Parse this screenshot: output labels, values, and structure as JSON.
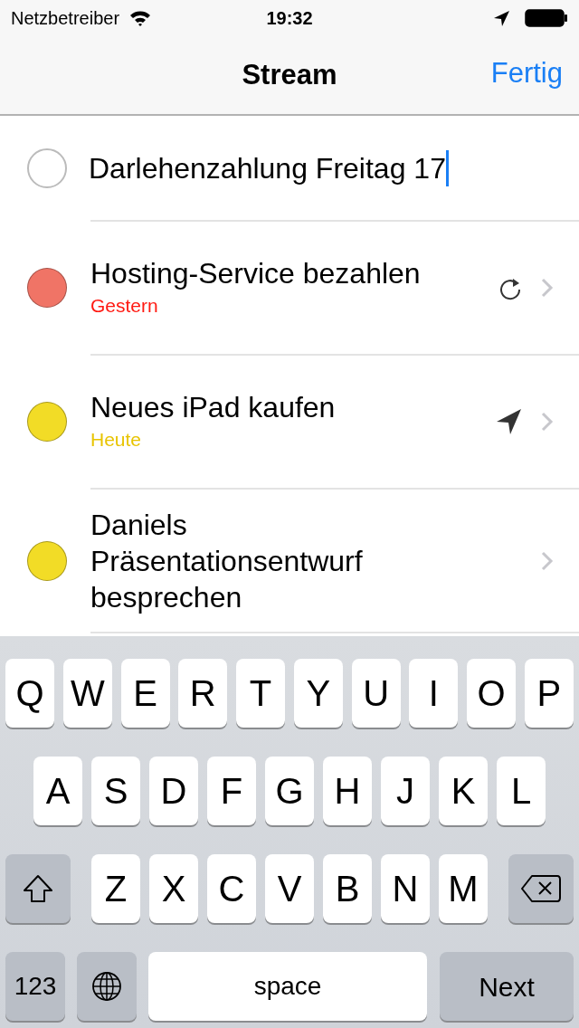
{
  "status_bar": {
    "carrier": "Netzbetreiber",
    "time": "19:32"
  },
  "nav": {
    "title": "Stream",
    "done": "Fertig"
  },
  "new_task": {
    "value": "Darlehenzahlung Freitag 17"
  },
  "tasks": [
    {
      "title": "Hosting-Service bezahlen",
      "color": "#f07466",
      "due": {
        "text": "Gestern",
        "color": "#ff1a12"
      },
      "kind": "repeat"
    },
    {
      "title": "Neues iPad kaufen",
      "color": "#f2dc26",
      "due": {
        "text": "Heute",
        "color": "#e8c400"
      },
      "kind": "location"
    },
    {
      "title": "Daniels Präsentationsentwurf besprechen",
      "color": "#f2dc26",
      "kind": "plain"
    }
  ],
  "keyboard": {
    "rows": [
      {
        "keys": [
          {
            "kind": "letter",
            "label": "Q"
          },
          {
            "kind": "letter",
            "label": "W"
          },
          {
            "kind": "letter",
            "label": "E"
          },
          {
            "kind": "letter",
            "label": "R"
          },
          {
            "kind": "letter",
            "label": "T"
          },
          {
            "kind": "letter",
            "label": "Y"
          },
          {
            "kind": "letter",
            "label": "U"
          },
          {
            "kind": "letter",
            "label": "I"
          },
          {
            "kind": "letter",
            "label": "O"
          },
          {
            "kind": "letter",
            "label": "P"
          }
        ]
      },
      {
        "keys": [
          {
            "kind": "letter",
            "label": "A"
          },
          {
            "kind": "letter",
            "label": "S"
          },
          {
            "kind": "letter",
            "label": "D"
          },
          {
            "kind": "letter",
            "label": "F"
          },
          {
            "kind": "letter",
            "label": "G"
          },
          {
            "kind": "letter",
            "label": "H"
          },
          {
            "kind": "letter",
            "label": "J"
          },
          {
            "kind": "letter",
            "label": "K"
          },
          {
            "kind": "letter",
            "label": "L"
          }
        ]
      },
      {
        "keys": [
          {
            "kind": "shift"
          },
          {
            "kind": "letter",
            "label": "Z"
          },
          {
            "kind": "letter",
            "label": "X"
          },
          {
            "kind": "letter",
            "label": "C"
          },
          {
            "kind": "letter",
            "label": "V"
          },
          {
            "kind": "letter",
            "label": "B"
          },
          {
            "kind": "letter",
            "label": "N"
          },
          {
            "kind": "letter",
            "label": "M"
          },
          {
            "kind": "delete"
          }
        ]
      },
      {
        "keys": [
          {
            "kind": "numbers",
            "label": "123"
          },
          {
            "kind": "globe"
          },
          {
            "kind": "space",
            "label": "space"
          },
          {
            "kind": "return",
            "label": "Next"
          }
        ]
      }
    ]
  }
}
